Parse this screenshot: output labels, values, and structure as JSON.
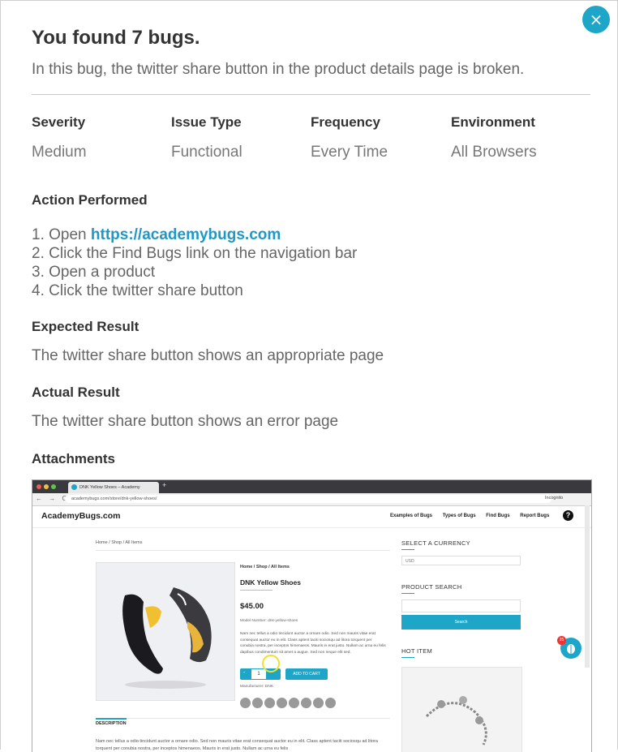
{
  "modal": {
    "title": "You found 7 bugs.",
    "subtitle": "In this bug, the twitter share button in the product details page is broken.",
    "close_icon": "close-icon",
    "close_glyph": "×"
  },
  "meta": [
    {
      "label": "Severity",
      "value": "Medium"
    },
    {
      "label": "Issue Type",
      "value": "Functional"
    },
    {
      "label": "Frequency",
      "value": "Every Time"
    },
    {
      "label": "Environment",
      "value": "All Browsers"
    }
  ],
  "action": {
    "heading": "Action Performed",
    "steps": [
      {
        "prefix": "1. Open ",
        "link": "https://academybugs.com"
      },
      {
        "text": "2. Click the Find Bugs link on the navigation bar"
      },
      {
        "text": "3. Open a product"
      },
      {
        "text": "4. Click the twitter share button"
      }
    ]
  },
  "expected": {
    "heading": "Expected Result",
    "text": "The twitter share button shows an appropriate page"
  },
  "actual": {
    "heading": "Actual Result",
    "text": "The twitter share button shows an error page"
  },
  "attachments": {
    "heading": "Attachments",
    "screenshot": {
      "tab_title": "DNK Yellow Shoes – Academy",
      "tab_plus": "+",
      "nav_glyphs": "← → C",
      "url": "academybugs.com/store/dnk-yellow-shoes/",
      "incognito": "Incognito",
      "site_logo": "AcademyBugs.com",
      "nav_items": [
        "Examples of Bugs",
        "Types of Bugs",
        "Find Bugs",
        "Report Bugs"
      ],
      "help_glyph": "?",
      "breadcrumb_top": "Home / Shop / All Items",
      "breadcrumb_product": "Home / Shop / All Items",
      "product_name": "DNK Yellow Shoes",
      "price": "$45.00",
      "model_number": "Model Number: dnk-yellow-shoes",
      "description": "Nam nec tellus a odio tincidunt auctor a ornare odio. Sed non mauris vitae erat consequat auctor eu in elit. Class aptent taciti sociosqu ad litora torquent per conubia nostra, per inceptos himenaeos. Mauris in erat justo. Nullam ac urna eu felis dapibus condimentum sit amet a augue. Sed non neque elit sed.",
      "qty_value": "1",
      "qty_minus": "-",
      "add_to_cart": "ADD TO CART",
      "manufacturer": "Manufacturer: DNK",
      "currency_heading": "SELECT A CURRENCY",
      "currency_value": "USD",
      "search_heading": "PRODUCT SEARCH",
      "search_button": "Search",
      "hot_item_heading": "HOT ITEM",
      "bug_badge": "25",
      "description_tab": "DESCRIPTION",
      "footer_text": "Nam nec tellus a odio tincidunt auctor a ornare odio. Sed non mauris vitae erat consequat auctor eu in elit. Class aptent taciti sociosqu ad litora torquent per conubia nostra, per inceptos himenaeos. Mauris in erat justo. Nullam ac urna eu felis"
    }
  }
}
